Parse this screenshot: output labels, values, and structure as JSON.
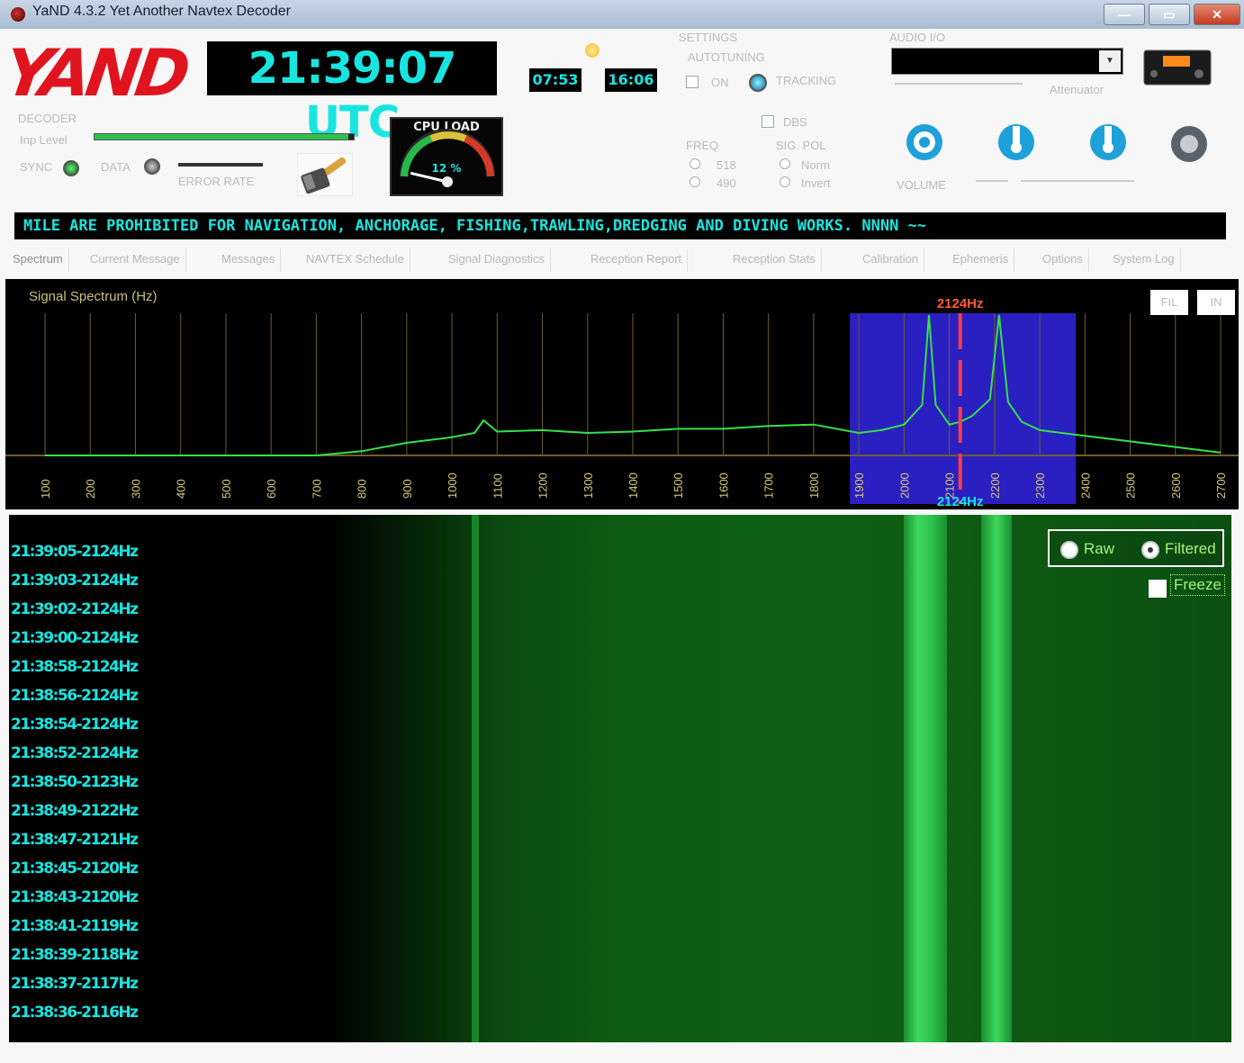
{
  "window": {
    "title": "YaND 4.3.2 Yet Another Navtex Decoder",
    "minimize": "—",
    "maximize": "▭",
    "close": "✕"
  },
  "header": {
    "logo_text": "YAND",
    "utc_clock": "21:39:07 UTC",
    "sunrise": "07:53",
    "sunset": "16:06",
    "decoder_label": "DECODER",
    "inp_level_label": "Inp Level",
    "inp_level": 0.98,
    "sync_label": "SYNC",
    "data_label": "DATA",
    "error_rate_label": "ERROR RATE",
    "cpu_title": "CPU LOAD",
    "cpu_value": "12 %",
    "cpu_load": 12
  },
  "settings": {
    "title": "SETTINGS",
    "autotuning_label": "AUTOTUNING",
    "on_label": "ON",
    "tracking_label": "TRACKING",
    "dbs_label": "DBS",
    "freq_label": "FREQ",
    "freq_options": [
      "518",
      "490"
    ],
    "sig_pol_label": "SIG. POL",
    "sig_pol_options": [
      "Norm",
      "Invert"
    ]
  },
  "audio": {
    "title": "AUDIO I/O",
    "device": "",
    "attenuator_label": "Attenuator",
    "volume_label": "VOLUME"
  },
  "ticker": "MILE ARE PROHIBITED FOR NAVIGATION, ANCHORAGE, FISHING,TRAWLING,DREDGING AND DIVING  WORKS. NNNN ~~",
  "tabs": [
    "Spectrum",
    "Current Message",
    "Messages",
    "NAVTEX Schedule",
    "Signal Diagnostics",
    "Reception Report",
    "Reception Stats",
    "Calibration",
    "Ephemeris",
    "Options",
    "System Log"
  ],
  "spectrum": {
    "title": "Signal Spectrum (Hz)",
    "marker_top": "2124Hz",
    "marker_bottom": "2124Hz",
    "btn_fil": "FIL",
    "btn_in": "IN",
    "colors": {
      "grid": "#6d5f2c",
      "trace": "#35e04a",
      "filter_band": "#2a1fc0",
      "marker": "#ff3b4a",
      "axis_label": "#d8c878"
    }
  },
  "chart_data": {
    "type": "line",
    "title": "Signal Spectrum (Hz)",
    "xlabel": "",
    "ylabel": "",
    "x_ticks": [
      100,
      200,
      300,
      400,
      500,
      600,
      700,
      800,
      900,
      1000,
      1100,
      1200,
      1300,
      1400,
      1500,
      1600,
      1700,
      1800,
      1900,
      2000,
      2100,
      2200,
      2300,
      2400,
      2500,
      2600,
      2700
    ],
    "xlim": [
      100,
      2700
    ],
    "ylim": [
      0,
      100
    ],
    "filter_band": [
      1880,
      2380
    ],
    "marker_hz": 2124,
    "series": [
      {
        "x": [
          100,
          200,
          300,
          400,
          500,
          600,
          700,
          800,
          900,
          1000,
          1050,
          1070,
          1100,
          1200,
          1300,
          1400,
          1500,
          1600,
          1700,
          1800,
          1900,
          1950,
          2000,
          2040,
          2055,
          2070,
          2100,
          2124,
          2150,
          2190,
          2210,
          2230,
          2260,
          2300,
          2400,
          2500,
          2600,
          2700
        ],
        "y": [
          0,
          0,
          0,
          0,
          0,
          0,
          0,
          3,
          9,
          13,
          16,
          25,
          17,
          18,
          16,
          17,
          19,
          19,
          21,
          22,
          16,
          18,
          22,
          36,
          100,
          36,
          22,
          24,
          28,
          40,
          100,
          38,
          24,
          18,
          14,
          10,
          6,
          2
        ]
      }
    ]
  },
  "waterfall": {
    "timestamps": [
      "21:39:05-2124Hz",
      "21:39:03-2124Hz",
      "21:39:02-2124Hz",
      "21:39:00-2124Hz",
      "21:38:58-2124Hz",
      "21:38:56-2124Hz",
      "21:38:54-2124Hz",
      "21:38:52-2124Hz",
      "21:38:50-2123Hz",
      "21:38:49-2122Hz",
      "21:38:47-2121Hz",
      "21:38:45-2120Hz",
      "21:38:43-2120Hz",
      "21:38:41-2119Hz",
      "21:38:39-2118Hz",
      "21:38:37-2117Hz",
      "21:38:36-2116Hz"
    ],
    "raw_label": "Raw",
    "filtered_label": "Filtered",
    "freeze_label": "Freeze",
    "mode": "Filtered"
  }
}
